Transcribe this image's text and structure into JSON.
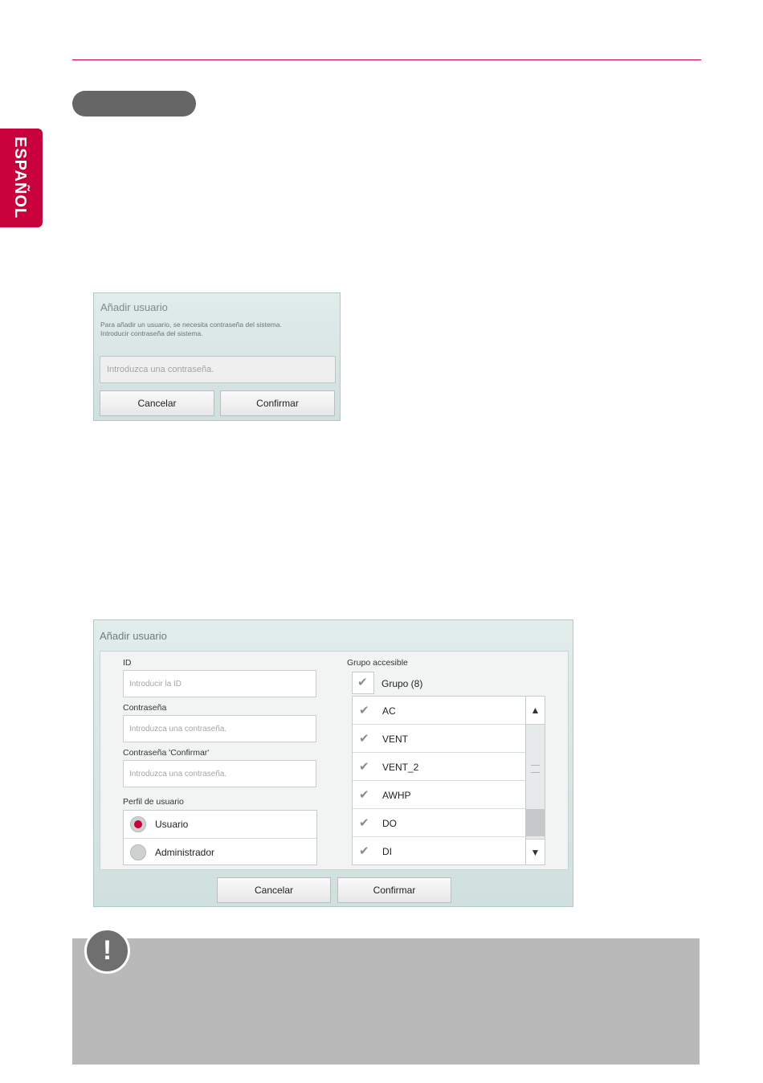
{
  "side_tab": {
    "label": "ESPAÑOL"
  },
  "dialog_password": {
    "title": "Añadir usuario",
    "description_line1": "Para añadir un usuario, se necesita contraseña del sistema.",
    "description_line2": "Introducir contraseña del sistema.",
    "password_placeholder": "Introduzca una contraseña.",
    "cancel_label": "Cancelar",
    "confirm_label": "Confirmar"
  },
  "dialog_add_user": {
    "title": "Añadir usuario",
    "id_label": "ID",
    "id_placeholder": "Introducir la ID",
    "password_label": "Contraseña",
    "password_placeholder": "Introduzca una contraseña.",
    "password_confirm_label": "Contraseña 'Confirmar'",
    "password_confirm_placeholder": "Introduzca una contraseña.",
    "profile_label": "Perfil de usuario",
    "profile_options": [
      {
        "label": "Usuario",
        "selected": true
      },
      {
        "label": "Administrador",
        "selected": false
      }
    ],
    "group_label": "Grupo accesible",
    "group_header": "Grupo (8)",
    "groups": [
      {
        "name": "AC",
        "checked": true
      },
      {
        "name": "VENT",
        "checked": true
      },
      {
        "name": "VENT_2",
        "checked": true
      },
      {
        "name": "AWHP",
        "checked": true
      },
      {
        "name": "DO",
        "checked": true
      },
      {
        "name": "DI",
        "checked": true
      }
    ],
    "cancel_label": "Cancelar",
    "confirm_label": "Confirmar"
  },
  "note": {
    "icon": "!"
  },
  "colors": {
    "accent": "#c8003c",
    "dialog_bg": "#d7e6e4",
    "note_bg": "#b9b9b9"
  }
}
